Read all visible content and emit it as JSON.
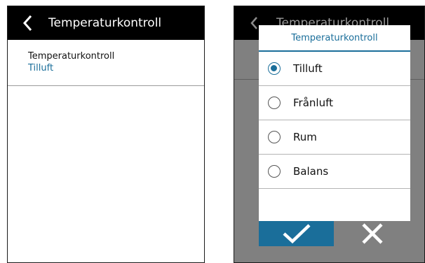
{
  "left_screen": {
    "header": {
      "title": "Temperaturkontroll",
      "back_icon": "chevron-left-icon"
    },
    "setting": {
      "label": "Temperaturkontroll",
      "value": "Tilluft"
    }
  },
  "right_screen": {
    "background_header": {
      "title": "Temperaturkontroll",
      "back_icon": "chevron-left-icon"
    },
    "dialog": {
      "title": "Temperaturkontroll",
      "selected": "Tilluft",
      "options": [
        {
          "label": "Tilluft",
          "checked": true
        },
        {
          "label": "Frånluft",
          "checked": false
        },
        {
          "label": "Rum",
          "checked": false
        },
        {
          "label": "Balans",
          "checked": false
        }
      ],
      "confirm_icon": "checkmark-icon",
      "cancel_icon": "close-icon"
    }
  },
  "colors": {
    "accent": "#1a6e9a",
    "header_bg": "#000000",
    "dim_overlay": "#808080"
  }
}
